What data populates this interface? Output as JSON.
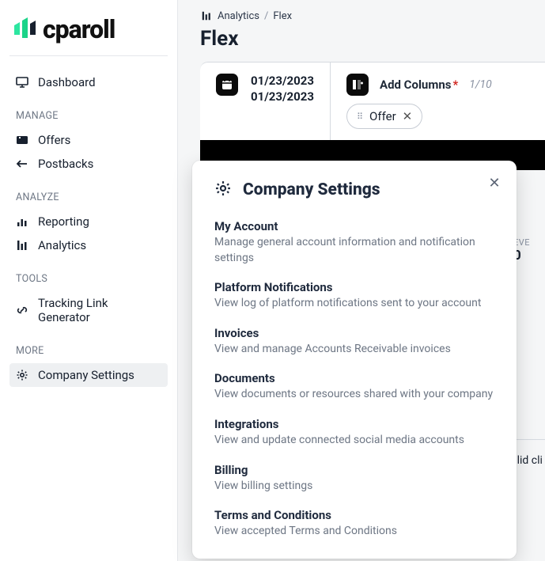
{
  "brand": {
    "name": "cparoll"
  },
  "sidebar": {
    "top": {
      "label": "Dashboard"
    },
    "sections": [
      {
        "header": "MANAGE",
        "items": [
          {
            "label": "Offers"
          },
          {
            "label": "Postbacks"
          }
        ]
      },
      {
        "header": "ANALYZE",
        "items": [
          {
            "label": "Reporting"
          },
          {
            "label": "Analytics"
          }
        ]
      },
      {
        "header": "TOOLS",
        "items": [
          {
            "label": "Tracking Link Generator"
          }
        ]
      },
      {
        "header": "MORE",
        "items": [
          {
            "label": "Company Settings",
            "active": true
          }
        ]
      }
    ]
  },
  "breadcrumb": {
    "section": "Analytics",
    "page": "Flex"
  },
  "page": {
    "title": "Flex"
  },
  "daterange": {
    "start": "01/23/2023",
    "end": "01/23/2023"
  },
  "columns": {
    "label": "Add Columns",
    "counter": "1/10",
    "chip": "Offer"
  },
  "rhs": {
    "events_label": "EVE",
    "events_value": "0",
    "truncated": "alid cli"
  },
  "popover": {
    "title": "Company Settings",
    "items": [
      {
        "title": "My Account",
        "desc": "Manage general account information and notification settings"
      },
      {
        "title": "Platform Notifications",
        "desc": "View log of platform notifications sent to your account"
      },
      {
        "title": "Invoices",
        "desc": "View and manage Accounts Receivable invoices"
      },
      {
        "title": "Documents",
        "desc": "View documents or resources shared with your company"
      },
      {
        "title": "Integrations",
        "desc": "View and update connected social media accounts"
      },
      {
        "title": "Billing",
        "desc": "View billing settings"
      },
      {
        "title": "Terms and Conditions",
        "desc": "View accepted Terms and Conditions"
      }
    ]
  }
}
